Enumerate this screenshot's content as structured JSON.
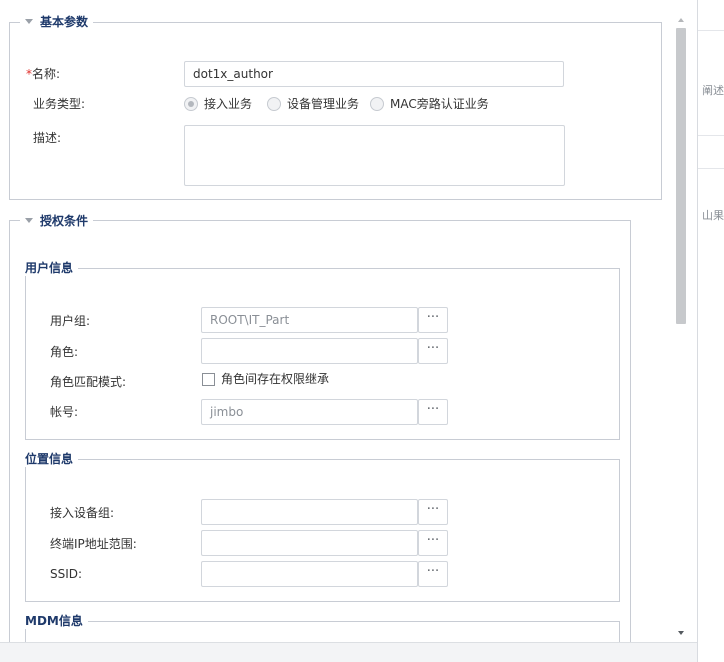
{
  "basic_params": {
    "legend": "基本参数",
    "name_label": "名称:",
    "name_value": "dot1x_author",
    "service_type_label": "业务类型:",
    "service_options": [
      {
        "label": "接入业务",
        "selected": true
      },
      {
        "label": "设备管理业务",
        "selected": false
      },
      {
        "label": "MAC旁路认证业务",
        "selected": false
      }
    ],
    "description_label": "描述:",
    "description_value": ""
  },
  "auth_conditions": {
    "legend": "授权条件",
    "user_info": {
      "legend": "用户信息",
      "user_group_label": "用户组:",
      "user_group_value": "ROOT\\IT_Part",
      "role_label": "角色:",
      "role_value": "",
      "role_match_label": "角色匹配模式:",
      "role_inherit_label": "角色间存在权限继承",
      "role_inherit_checked": false,
      "account_label": "帐号:",
      "account_value": "jimbo"
    },
    "location_info": {
      "legend": "位置信息",
      "device_group_label": "接入设备组:",
      "device_group_value": "",
      "ip_range_label": "终端IP地址范围:",
      "ip_range_value": "",
      "ssid_label": "SSID:",
      "ssid_value": ""
    },
    "mdm_info": {
      "legend": "MDM信息"
    }
  },
  "browse_label": "···",
  "right_panel": {
    "text1": "阐述",
    "text2": "山果"
  }
}
